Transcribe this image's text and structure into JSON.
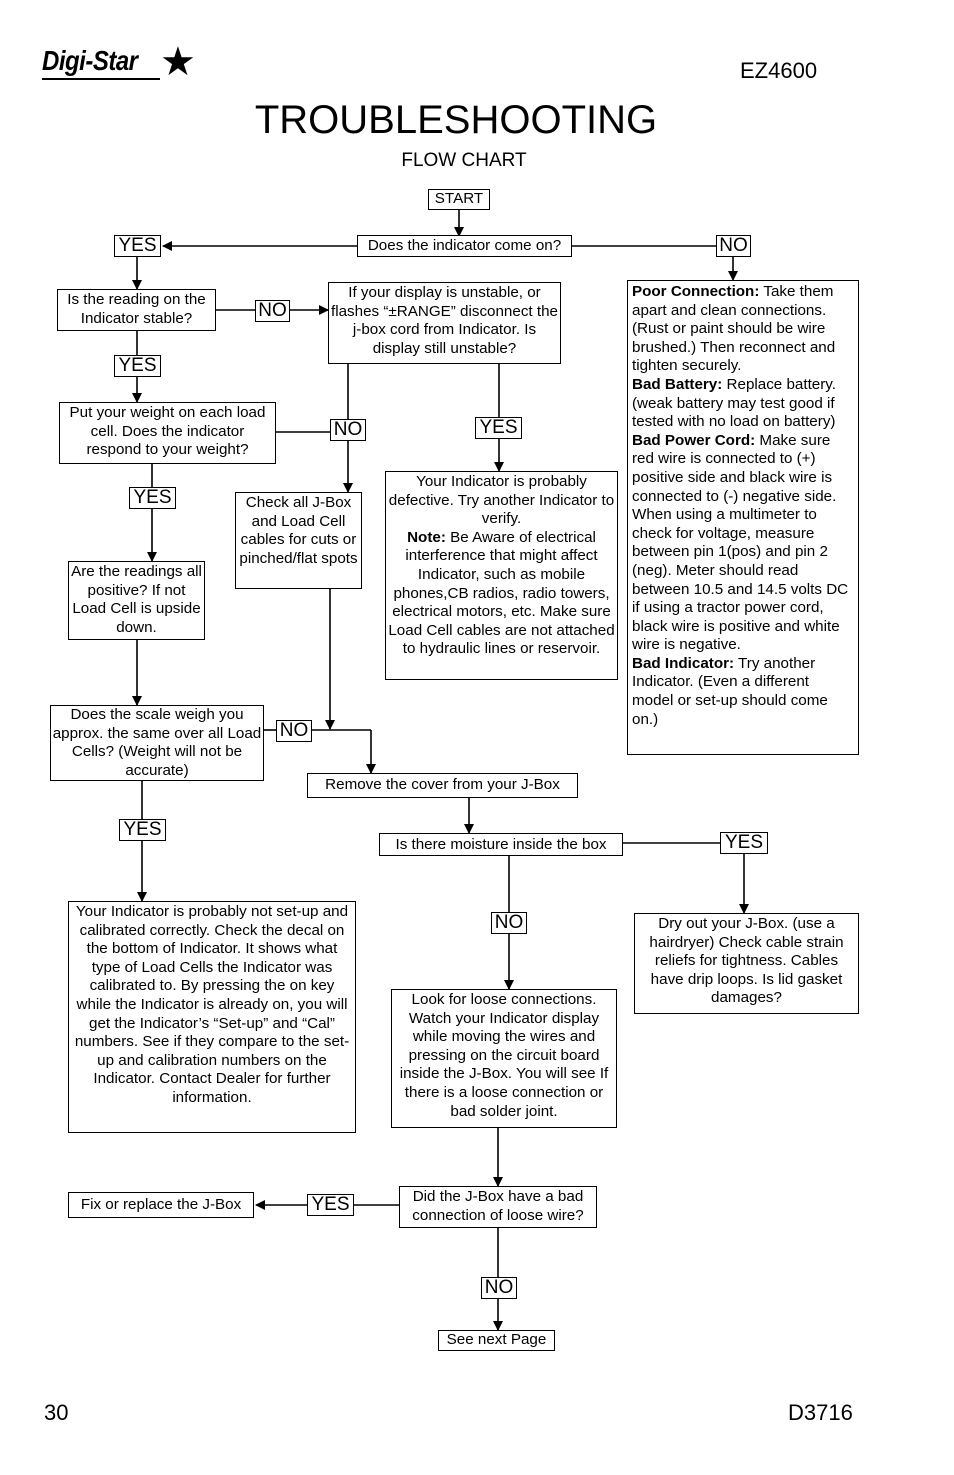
{
  "header": {
    "brand": "Digi-Star",
    "model": "EZ4600",
    "title": "TROUBLESHOOTING",
    "subtitle": "FLOW CHART"
  },
  "footer": {
    "page_number": "30",
    "document_number": "D3716"
  },
  "labels": {
    "yes": "YES",
    "no": "NO"
  },
  "nodes": {
    "start": "START",
    "q_indicator_on": "Does the indicator come on?",
    "q_reading_stable": "Is the reading on the Indicator stable?",
    "q_display_unstable": "If your display is unstable, or flashes “±RANGE” disconnect the j-box cord from Indicator. Is display still unstable?",
    "q_put_weight": "Put your weight on each load cell. Does the indicator respond to your weight?",
    "a_check_cables": "Check all J-Box and Load Cell cables for cuts or pinched/flat spots",
    "a_indicator_defective": {
      "intro": "Your Indicator is probably defective. Try another Indicator to verify.",
      "note_label": "Note:",
      "note_text": " Be Aware of electrical interference that might affect Indicator, such as mobile phones,CB radios, radio towers, electrical motors, etc. Make sure Load Cell cables are not attached to hydraulic lines or reservoir."
    },
    "a_no_power": {
      "poor_connection_label": "Poor Connection:",
      "poor_connection_text": " Take them apart and clean connections. (Rust or paint should be wire brushed.) Then reconnect and tighten securely.",
      "bad_battery_label": "Bad Battery:",
      "bad_battery_text": " Replace battery. (weak battery may test good if tested with no load on battery)",
      "bad_power_cord_label": "Bad Power Cord:",
      "bad_power_cord_text": " Make sure red wire is connected to (+) positive side and black wire is connected to (-) negative side. When using a multimeter to check for voltage, measure between pin 1(pos) and pin 2 (neg). Meter should read between 10.5 and 14.5 volts DC if using a tractor power cord, black wire is positive and white wire is negative.",
      "bad_indicator_label": "Bad Indicator:",
      "bad_indicator_text": " Try another Indicator. (Even a different model or set-up should come on.)"
    },
    "q_readings_positive": "Are the readings all positive? If not Load Cell is upside down.",
    "q_scale_weigh_same": "Does the scale weigh you approx. the same over all Load Cells? (Weight will not be accurate)",
    "a_remove_cover": "Remove the cover from your J-Box",
    "q_moisture": "Is there moisture inside the box",
    "a_not_calibrated": "Your Indicator is probably not set-up and calibrated correctly. Check the decal on the bottom of Indicator. It shows what type of Load Cells the Indicator was calibrated to. By pressing the on key while the Indicator is already on, you will get the Indicator’s “Set-up” and “Cal” numbers. See if they compare to the set-up and calibration numbers on the Indicator. Contact Dealer for further information.",
    "a_dry_out": "Dry out your J-Box. (use a hairdryer) Check cable strain reliefs for tightness. Cables have drip loops. Is lid gasket damages?",
    "a_loose_connections": "Look for loose connections. Watch your Indicator display while moving the wires and pressing on the circuit board inside the J-Box. You will see If there is a loose connection or bad solder joint.",
    "q_bad_connection": "Did the J-Box have a bad connection of loose wire?",
    "a_fix_replace": "Fix or replace the J-Box",
    "a_see_next_page": "See next Page"
  }
}
